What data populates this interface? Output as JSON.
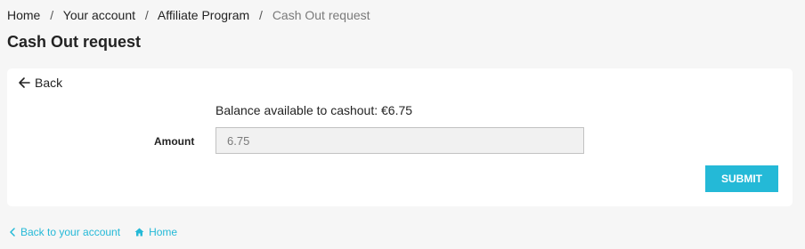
{
  "breadcrumb": {
    "items": [
      "Home",
      "Your account",
      "Affiliate Program"
    ],
    "current": "Cash Out request",
    "separator": "/"
  },
  "page": {
    "title": "Cash Out request"
  },
  "form": {
    "back_label": "Back",
    "balance_text": "Balance available to cashout: €6.75",
    "amount_label": "Amount",
    "amount_value": "6.75",
    "submit_label": "SUBMIT"
  },
  "footer": {
    "back_account_label": "Back to your account",
    "home_label": "Home"
  },
  "colors": {
    "accent": "#24b9d7",
    "background": "#f6f6f6",
    "card": "#ffffff"
  },
  "icons": [
    "arrow-left-icon",
    "chevron-left-icon",
    "home-icon"
  ]
}
